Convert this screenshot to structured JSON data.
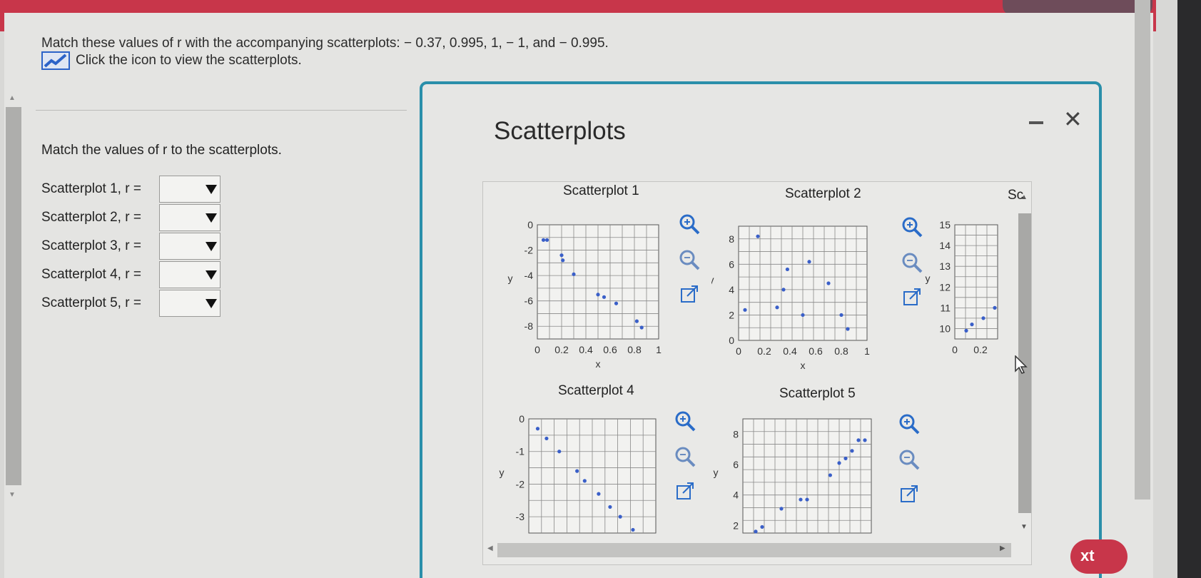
{
  "question": {
    "text": "Match these values of r with the accompanying scatterplots:  − 0.37, 0.995, 1,  − 1, and  − 0.995.",
    "view_link": "Click the icon to view the scatterplots."
  },
  "matching": {
    "title": "Match the values of r to the scatterplots.",
    "rows": [
      {
        "label": "Scatterplot 1, r =",
        "value": ""
      },
      {
        "label": "Scatterplot 2, r =",
        "value": ""
      },
      {
        "label": "Scatterplot 3, r =",
        "value": ""
      },
      {
        "label": "Scatterplot 4, r =",
        "value": ""
      },
      {
        "label": "Scatterplot 5, r =",
        "value": ""
      }
    ]
  },
  "dialog": {
    "title": "Scatterplots",
    "partial_title": "Sc"
  },
  "next_button": "xt",
  "colors": {
    "accent_red": "#c8364a",
    "dialog_border": "#2a8faa",
    "point_blue": "#3a5fc8"
  },
  "icons": [
    "chart-icon",
    "zoom-in-icon",
    "zoom-out-icon",
    "popout-icon",
    "close-icon",
    "minimize-icon"
  ],
  "chart_data": [
    {
      "type": "scatter",
      "title": "Scatterplot 1",
      "xlabel": "x",
      "ylabel": "y",
      "xlim": [
        0,
        1
      ],
      "ylim": [
        -9,
        0
      ],
      "xticks": [
        "0",
        "0.2",
        "0.4",
        "0.6",
        "0.8",
        "1"
      ],
      "yticks": [
        "0",
        "-2",
        "-4",
        "-6",
        "-8"
      ],
      "x": [
        0.05,
        0.08,
        0.2,
        0.21,
        0.3,
        0.5,
        0.55,
        0.65,
        0.82,
        0.86
      ],
      "y": [
        -1.2,
        -1.2,
        -2.4,
        -2.8,
        -3.9,
        -5.5,
        -5.7,
        -6.2,
        -7.6,
        -8.1
      ]
    },
    {
      "type": "scatter",
      "title": "Scatterplot 2",
      "xlabel": "x",
      "ylabel": "y",
      "xlim": [
        0,
        1
      ],
      "ylim": [
        0,
        9
      ],
      "xticks": [
        "0",
        "0.2",
        "0.4",
        "0.6",
        "0.8",
        "1"
      ],
      "yticks": [
        "0",
        "2",
        "4",
        "6",
        "8"
      ],
      "x": [
        0.05,
        0.15,
        0.3,
        0.35,
        0.38,
        0.5,
        0.55,
        0.7,
        0.8,
        0.85
      ],
      "y": [
        2.4,
        8.2,
        2.6,
        4.0,
        5.6,
        2.0,
        6.2,
        4.5,
        2.0,
        0.9
      ]
    },
    {
      "type": "scatter",
      "title": "",
      "xlabel": "",
      "ylabel": "y",
      "xlim": [
        0,
        0.3
      ],
      "ylim": [
        9.5,
        15
      ],
      "xticks": [
        "0",
        "0.2"
      ],
      "yticks": [
        "15",
        "14",
        "13",
        "12",
        "11",
        "10"
      ],
      "x": [
        0.08,
        0.12,
        0.2,
        0.28
      ],
      "y": [
        9.9,
        10.2,
        10.5,
        11.0
      ]
    },
    {
      "type": "scatter",
      "title": "Scatterplot 4",
      "xlabel": "",
      "ylabel": "y",
      "xlim": [
        0,
        1
      ],
      "ylim": [
        -3.5,
        0
      ],
      "yticks": [
        "0",
        "-1",
        "-2",
        "-3"
      ],
      "x": [
        0.07,
        0.14,
        0.24,
        0.38,
        0.44,
        0.55,
        0.64,
        0.72,
        0.82
      ],
      "y": [
        -0.3,
        -0.6,
        -1.0,
        -1.6,
        -1.9,
        -2.3,
        -2.7,
        -3.0,
        -3.4
      ]
    },
    {
      "type": "scatter",
      "title": "Scatterplot 5",
      "xlabel": "",
      "ylabel": "y",
      "xlim": [
        0,
        1
      ],
      "ylim": [
        1.5,
        9
      ],
      "yticks": [
        "8",
        "6",
        "4",
        "2"
      ],
      "x": [
        0.1,
        0.15,
        0.3,
        0.45,
        0.5,
        0.68,
        0.75,
        0.8,
        0.85,
        0.9,
        0.95
      ],
      "y": [
        1.6,
        1.9,
        3.1,
        3.7,
        3.7,
        5.3,
        6.1,
        6.4,
        6.9,
        7.6,
        7.6
      ]
    }
  ]
}
